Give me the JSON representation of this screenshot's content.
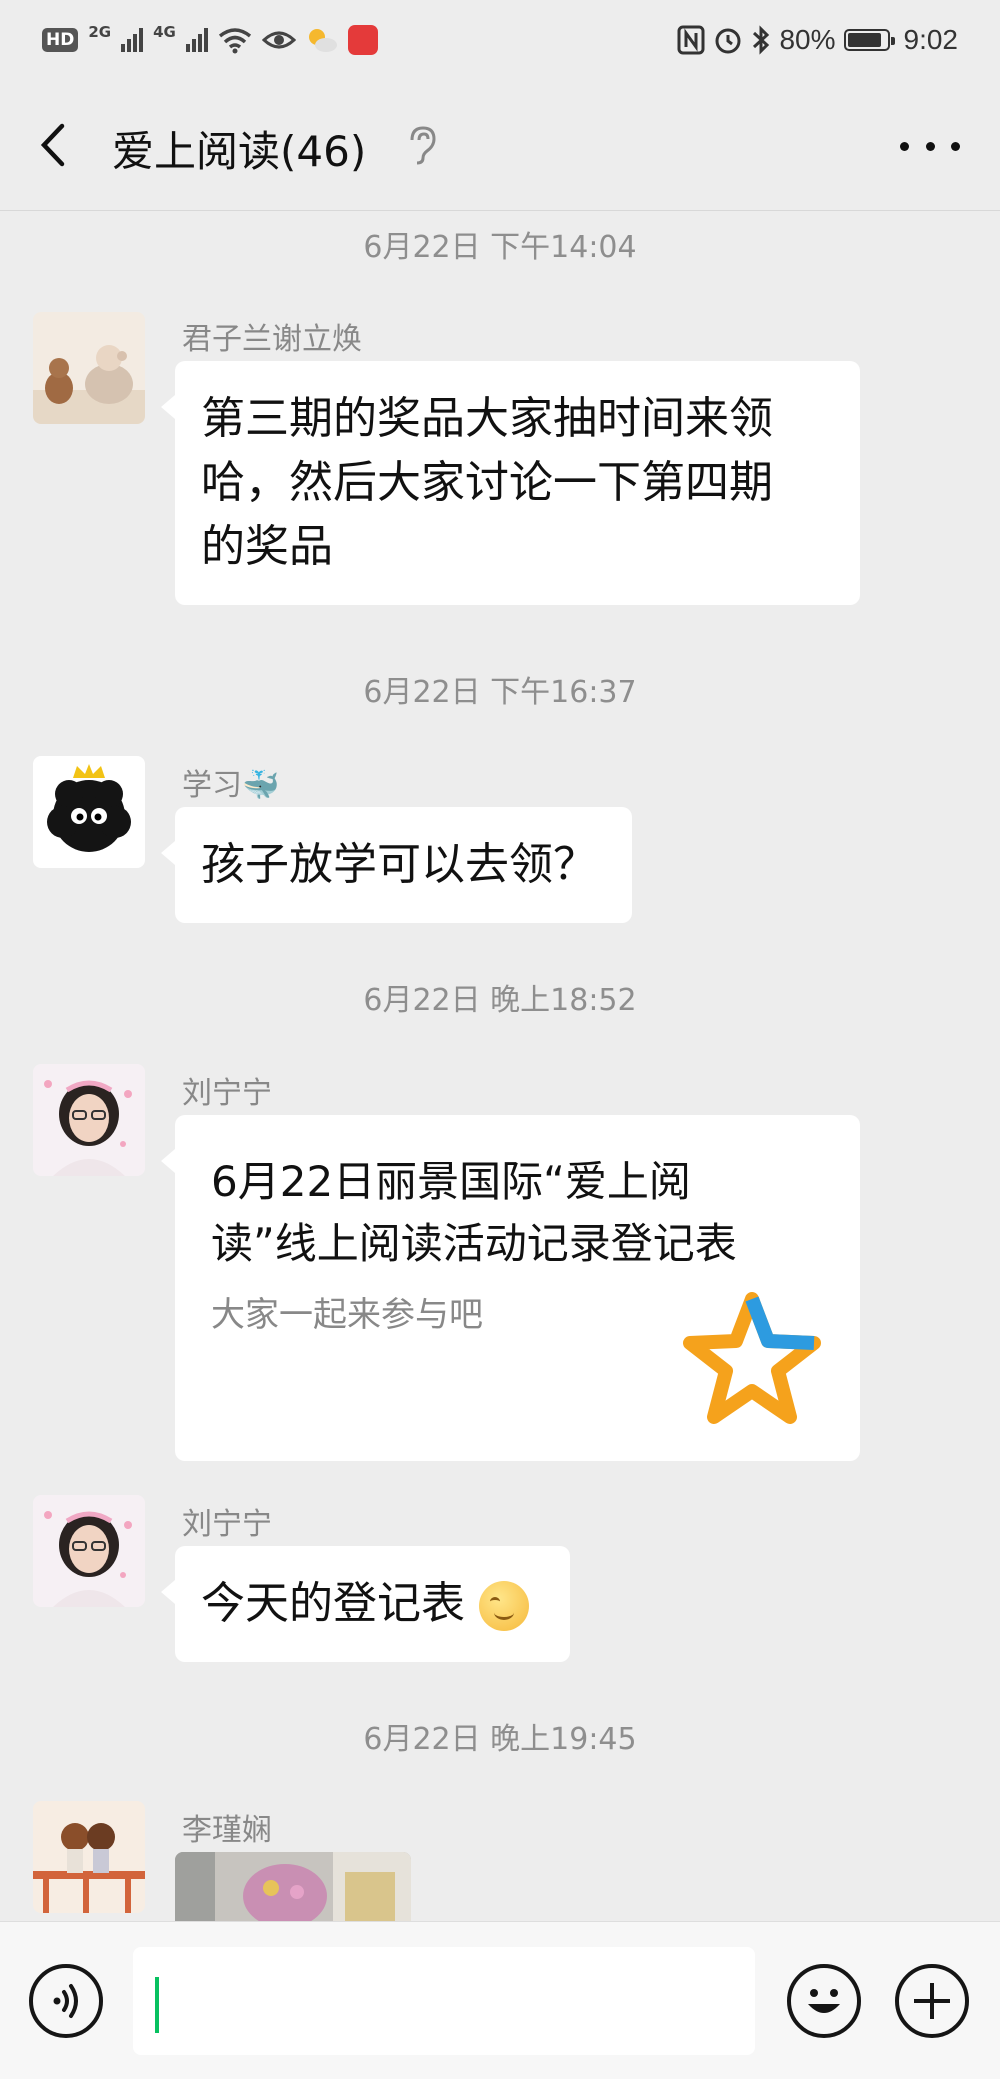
{
  "status_bar": {
    "network_badge": "HD",
    "network_badge_sub": "2",
    "net_2g": "2G",
    "net_4g": "4G",
    "battery": "80%",
    "time": "9:02",
    "icons": [
      "hd-icon",
      "signal-icon",
      "wifi-icon",
      "eye-icon",
      "weather-icon",
      "huawei-app-icon",
      "nfc-icon",
      "alarm-icon",
      "bluetooth-icon",
      "battery-icon"
    ]
  },
  "header": {
    "title": "爱上阅读(46)",
    "back_icon": "chevron-left-icon",
    "mute_icon": "ear-icon",
    "more_icon": "more-dots-icon"
  },
  "messages": [
    {
      "type": "timestamp",
      "text": "6月22日 下午14:04"
    },
    {
      "type": "text",
      "sender": "君子兰谢立焕",
      "lines": [
        "第三期的奖品大家抽时间来领",
        "哈，然后大家讨论一下第四期",
        "的奖品"
      ]
    },
    {
      "type": "timestamp",
      "text": "6月22日 下午16:37"
    },
    {
      "type": "text",
      "sender": "学习🐳",
      "lines": [
        "孩子放学可以去领？"
      ]
    },
    {
      "type": "timestamp",
      "text": "6月22日 晚上18:52"
    },
    {
      "type": "card",
      "sender": "刘宁宁",
      "title_lines": [
        "6月22日丽景国际“爱上阅",
        "读”线上阅读活动记录登记表"
      ],
      "desc": "大家一起来参与吧",
      "thumb_icon": "star-icon"
    },
    {
      "type": "text",
      "sender": "刘宁宁",
      "lines": [
        "今天的登记表"
      ],
      "emoji": "smiling-face-icon"
    },
    {
      "type": "timestamp",
      "text": "6月22日 晚上19:45"
    },
    {
      "type": "image",
      "sender": "李瑾娴"
    }
  ],
  "input_bar": {
    "voice_icon": "voice-icon",
    "emoji_icon": "emoji-icon",
    "plus_icon": "plus-icon",
    "value": ""
  },
  "colors": {
    "background": "#ededed",
    "bubble": "#ffffff",
    "timestamp": "#8e8e8e",
    "sender": "#888888",
    "caret": "#07c160"
  }
}
